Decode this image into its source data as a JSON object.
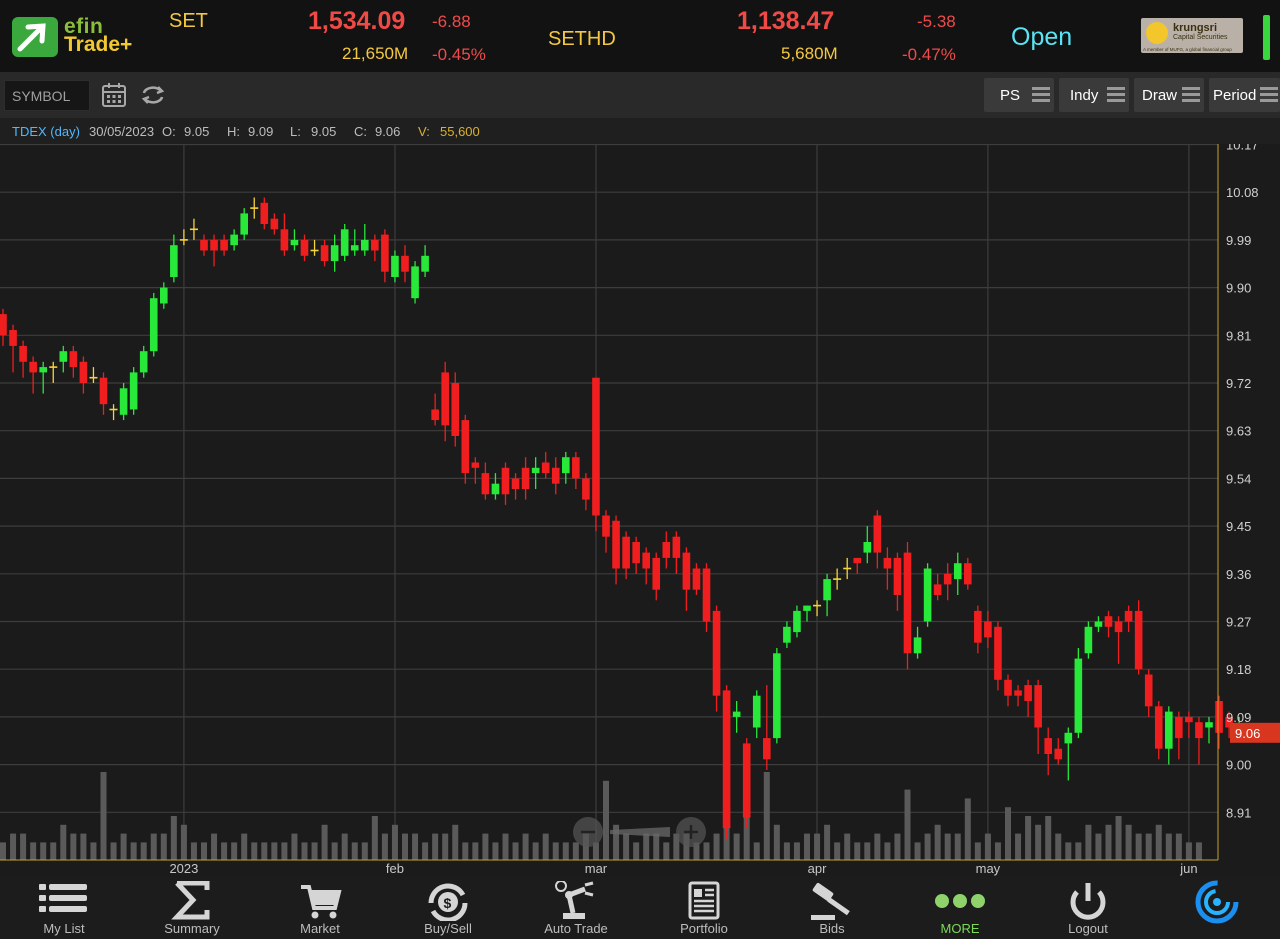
{
  "header": {
    "logo_top": "efin",
    "logo_bottom": "Trade+",
    "index1": {
      "name": "SET",
      "value": "1,534.09",
      "change": "-6.88",
      "volume": "21,650M",
      "pct": "-0.45%"
    },
    "index2": {
      "name": "SETHD",
      "value": "1,138.47",
      "change": "-5.38",
      "volume": "5,680M",
      "pct": "-0.47%"
    },
    "market_status": "Open",
    "broker": {
      "name": "krungsri",
      "sub": "Capital Securities",
      "tag": "A member of MUFG, a global financial group"
    }
  },
  "toolbar": {
    "symbol_placeholder": "SYMBOL",
    "buttons": {
      "ps": "PS",
      "indy": "Indy",
      "draw": "Draw",
      "period": "Period"
    }
  },
  "info": {
    "symbol": "TDEX (day)",
    "date": "30/05/2023",
    "open_label": "O:",
    "open": "9.05",
    "high_label": "H:",
    "high": "9.09",
    "low_label": "L:",
    "low": "9.05",
    "close_label": "C:",
    "close": "9.06",
    "vol_label": "V:",
    "vol": "55,600"
  },
  "colors": {
    "up": "#28e83a",
    "down": "#f01e1e",
    "doji": "#f5d33a",
    "last_price_bg": "#d8361e",
    "grid": "#3d3d3d",
    "axis": "#c9a227"
  },
  "chart_data": {
    "type": "candlestick",
    "y_ticks": [
      "10.17",
      "10.08",
      "9.99",
      "9.90",
      "9.81",
      "9.72",
      "9.63",
      "9.54",
      "9.45",
      "9.36",
      "9.27",
      "9.18",
      "9.09",
      "9.00",
      "8.91"
    ],
    "ylim": [
      8.82,
      10.17
    ],
    "x_ticks": [
      {
        "label": "2023",
        "idx": 18
      },
      {
        "label": "feb",
        "idx": 39
      },
      {
        "label": "mar",
        "idx": 59
      },
      {
        "label": "apr",
        "idx": 81
      },
      {
        "label": "may",
        "idx": 98
      },
      {
        "label": "jun",
        "idx": 118
      }
    ],
    "last_price": "9.06",
    "candles": [
      [
        9.85,
        9.81,
        9.86,
        9.79
      ],
      [
        9.82,
        9.79,
        9.83,
        9.74
      ],
      [
        9.79,
        9.76,
        9.8,
        9.73
      ],
      [
        9.76,
        9.74,
        9.77,
        9.7
      ],
      [
        9.74,
        9.75,
        9.76,
        9.7
      ],
      [
        9.75,
        9.75,
        9.76,
        9.72
      ],
      [
        9.76,
        9.78,
        9.79,
        9.74
      ],
      [
        9.78,
        9.75,
        9.79,
        9.73
      ],
      [
        9.76,
        9.72,
        9.77,
        9.7
      ],
      [
        9.73,
        9.73,
        9.75,
        9.72
      ],
      [
        9.73,
        9.68,
        9.74,
        9.66
      ],
      [
        9.67,
        9.67,
        9.68,
        9.65
      ],
      [
        9.66,
        9.71,
        9.72,
        9.65
      ],
      [
        9.67,
        9.74,
        9.75,
        9.66
      ],
      [
        9.74,
        9.78,
        9.79,
        9.73
      ],
      [
        9.78,
        9.88,
        9.89,
        9.77
      ],
      [
        9.87,
        9.9,
        9.91,
        9.86
      ],
      [
        9.92,
        9.98,
        10.0,
        9.91
      ],
      [
        9.99,
        9.99,
        10.01,
        9.98
      ],
      [
        10.01,
        10.01,
        10.03,
        9.99
      ],
      [
        9.99,
        9.97,
        10.0,
        9.96
      ],
      [
        9.99,
        9.97,
        10.0,
        9.94
      ],
      [
        9.99,
        9.97,
        10.0,
        9.96
      ],
      [
        9.98,
        10.0,
        10.01,
        9.97
      ],
      [
        10.0,
        10.04,
        10.05,
        9.99
      ],
      [
        10.05,
        10.05,
        10.07,
        10.03
      ],
      [
        10.06,
        10.02,
        10.07,
        10.01
      ],
      [
        10.03,
        10.01,
        10.04,
        10.0
      ],
      [
        10.01,
        9.97,
        10.04,
        9.96
      ],
      [
        9.98,
        9.99,
        10.01,
        9.97
      ],
      [
        9.99,
        9.96,
        10.0,
        9.95
      ],
      [
        9.97,
        9.97,
        9.99,
        9.96
      ],
      [
        9.98,
        9.95,
        9.99,
        9.94
      ],
      [
        9.95,
        9.98,
        10.0,
        9.93
      ],
      [
        9.96,
        10.01,
        10.02,
        9.95
      ],
      [
        9.97,
        9.98,
        10.01,
        9.96
      ],
      [
        9.97,
        9.99,
        10.02,
        9.96
      ],
      [
        9.99,
        9.97,
        10.0,
        9.95
      ],
      [
        10.0,
        9.93,
        10.01,
        9.91
      ],
      [
        9.92,
        9.96,
        9.97,
        9.91
      ],
      [
        9.96,
        9.93,
        9.98,
        9.91
      ],
      [
        9.88,
        9.94,
        9.95,
        9.87
      ],
      [
        9.93,
        9.96,
        9.98,
        9.92
      ],
      [
        9.67,
        9.65,
        9.7,
        9.64
      ],
      [
        9.74,
        9.64,
        9.76,
        9.61
      ],
      [
        9.72,
        9.62,
        9.74,
        9.6
      ],
      [
        9.65,
        9.55,
        9.66,
        9.53
      ],
      [
        9.57,
        9.56,
        9.58,
        9.53
      ],
      [
        9.55,
        9.51,
        9.57,
        9.5
      ],
      [
        9.51,
        9.53,
        9.55,
        9.5
      ],
      [
        9.56,
        9.51,
        9.57,
        9.49
      ],
      [
        9.54,
        9.52,
        9.55,
        9.5
      ],
      [
        9.56,
        9.52,
        9.58,
        9.5
      ],
      [
        9.55,
        9.56,
        9.58,
        9.52
      ],
      [
        9.57,
        9.55,
        9.59,
        9.54
      ],
      [
        9.56,
        9.53,
        9.58,
        9.51
      ],
      [
        9.55,
        9.58,
        9.59,
        9.53
      ],
      [
        9.58,
        9.54,
        9.59,
        9.52
      ],
      [
        9.54,
        9.5,
        9.55,
        9.48
      ],
      [
        9.73,
        9.47,
        9.73,
        9.44
      ],
      [
        9.47,
        9.43,
        9.48,
        9.4
      ],
      [
        9.46,
        9.37,
        9.47,
        9.34
      ],
      [
        9.43,
        9.37,
        9.44,
        9.35
      ],
      [
        9.42,
        9.38,
        9.43,
        9.36
      ],
      [
        9.4,
        9.37,
        9.41,
        9.34
      ],
      [
        9.39,
        9.33,
        9.4,
        9.31
      ],
      [
        9.42,
        9.39,
        9.44,
        9.37
      ],
      [
        9.43,
        9.39,
        9.44,
        9.36
      ],
      [
        9.4,
        9.33,
        9.41,
        9.29
      ],
      [
        9.37,
        9.33,
        9.38,
        9.32
      ],
      [
        9.37,
        9.27,
        9.38,
        9.25
      ],
      [
        9.29,
        9.13,
        9.3,
        9.1
      ],
      [
        9.14,
        8.88,
        9.15,
        8.86
      ],
      [
        9.09,
        9.1,
        9.12,
        9.06
      ],
      [
        9.04,
        8.9,
        9.05,
        8.88
      ],
      [
        9.07,
        9.13,
        9.14,
        9.05
      ],
      [
        9.05,
        9.01,
        9.15,
        8.99
      ],
      [
        9.05,
        9.21,
        9.22,
        9.04
      ],
      [
        9.23,
        9.26,
        9.27,
        9.22
      ],
      [
        9.25,
        9.29,
        9.3,
        9.24
      ],
      [
        9.29,
        9.3,
        9.3,
        9.27
      ],
      [
        9.3,
        9.3,
        9.31,
        9.28
      ],
      [
        9.31,
        9.35,
        9.36,
        9.28
      ],
      [
        9.35,
        9.35,
        9.37,
        9.33
      ],
      [
        9.37,
        9.37,
        9.39,
        9.35
      ],
      [
        9.39,
        9.38,
        9.39,
        9.36
      ],
      [
        9.4,
        9.42,
        9.45,
        9.38
      ],
      [
        9.47,
        9.4,
        9.48,
        9.37
      ],
      [
        9.39,
        9.37,
        9.41,
        9.33
      ],
      [
        9.39,
        9.32,
        9.4,
        9.29
      ],
      [
        9.4,
        9.21,
        9.42,
        9.18
      ],
      [
        9.21,
        9.24,
        9.26,
        9.2
      ],
      [
        9.27,
        9.37,
        9.38,
        9.26
      ],
      [
        9.34,
        9.32,
        9.36,
        9.31
      ],
      [
        9.36,
        9.34,
        9.38,
        9.31
      ],
      [
        9.35,
        9.38,
        9.4,
        9.32
      ],
      [
        9.38,
        9.34,
        9.39,
        9.33
      ],
      [
        9.29,
        9.23,
        9.3,
        9.21
      ],
      [
        9.27,
        9.24,
        9.29,
        9.22
      ],
      [
        9.26,
        9.16,
        9.27,
        9.14
      ],
      [
        9.16,
        9.13,
        9.17,
        9.11
      ],
      [
        9.14,
        9.13,
        9.15,
        9.11
      ],
      [
        9.15,
        9.12,
        9.16,
        9.09
      ],
      [
        9.15,
        9.07,
        9.16,
        9.02
      ],
      [
        9.05,
        9.02,
        9.07,
        8.98
      ],
      [
        9.03,
        9.01,
        9.05,
        9.0
      ],
      [
        9.04,
        9.06,
        9.07,
        8.97
      ],
      [
        9.06,
        9.2,
        9.22,
        9.05
      ],
      [
        9.21,
        9.26,
        9.27,
        9.2
      ],
      [
        9.26,
        9.27,
        9.28,
        9.25
      ],
      [
        9.28,
        9.26,
        9.29,
        9.24
      ],
      [
        9.27,
        9.25,
        9.28,
        9.19
      ],
      [
        9.29,
        9.27,
        9.3,
        9.25
      ],
      [
        9.29,
        9.18,
        9.31,
        9.17
      ],
      [
        9.17,
        9.11,
        9.18,
        9.09
      ],
      [
        9.11,
        9.03,
        9.12,
        9.01
      ],
      [
        9.03,
        9.1,
        9.11,
        9.0
      ],
      [
        9.09,
        9.05,
        9.1,
        9.01
      ],
      [
        9.09,
        9.08,
        9.1,
        9.05
      ],
      [
        9.08,
        9.05,
        9.09,
        9.0
      ],
      [
        9.07,
        9.08,
        9.09,
        9.04
      ],
      [
        9.12,
        9.06,
        9.13,
        9.03
      ],
      [
        9.09,
        9.07,
        9.1,
        9.05
      ],
      [
        9.05,
        9.06,
        9.09,
        9.05
      ]
    ],
    "volumes": [
      2,
      3,
      3,
      2,
      2,
      2,
      4,
      3,
      3,
      2,
      10,
      2,
      3,
      2,
      2,
      3,
      3,
      5,
      4,
      2,
      2,
      3,
      2,
      2,
      3,
      2,
      2,
      2,
      2,
      3,
      2,
      2,
      4,
      2,
      3,
      2,
      2,
      5,
      3,
      4,
      3,
      3,
      2,
      3,
      3,
      4,
      2,
      2,
      3,
      2,
      3,
      2,
      3,
      2,
      3,
      2,
      2,
      2,
      3,
      2,
      9,
      4,
      3,
      2,
      3,
      3,
      2,
      3,
      3,
      2,
      2,
      3,
      6,
      3,
      9,
      2,
      10,
      4,
      2,
      2,
      3,
      3,
      4,
      2,
      3,
      2,
      2,
      3,
      2,
      3,
      8,
      2,
      3,
      4,
      3,
      3,
      7,
      2,
      3,
      2,
      6,
      3,
      5,
      4,
      5,
      3,
      2,
      2,
      4,
      3,
      4,
      5,
      4,
      3,
      3,
      4,
      3,
      3,
      2,
      2
    ]
  },
  "nav": [
    {
      "label": "My List",
      "icon": "list-icon"
    },
    {
      "label": "Summary",
      "icon": "sigma-icon"
    },
    {
      "label": "Market",
      "icon": "cart-icon"
    },
    {
      "label": "Buy/Sell",
      "icon": "exchange-icon"
    },
    {
      "label": "Auto Trade",
      "icon": "robot-arm-icon"
    },
    {
      "label": "Portfolio",
      "icon": "document-icon"
    },
    {
      "label": "Bids",
      "icon": "gavel-icon"
    },
    {
      "label": "MORE",
      "icon": "more-dots-icon"
    },
    {
      "label": "Logout",
      "icon": "power-icon"
    }
  ]
}
